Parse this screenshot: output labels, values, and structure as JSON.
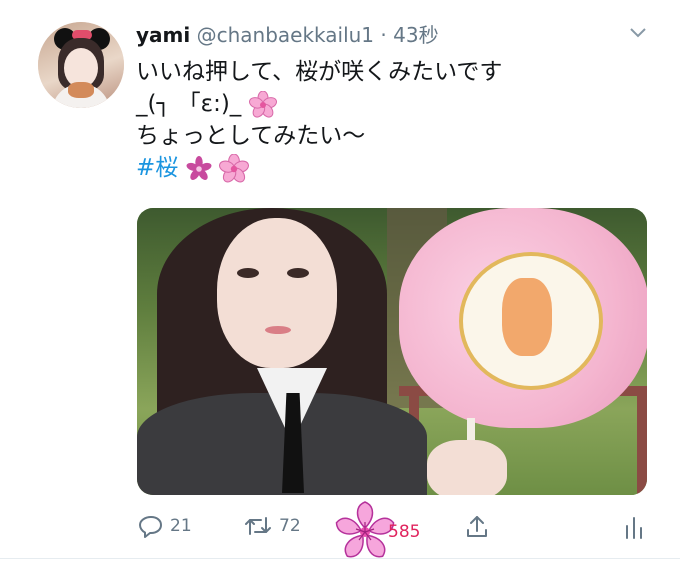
{
  "tweet": {
    "user": {
      "display_name": "yami",
      "handle": "@chanbaekkailu1",
      "separator": "·",
      "time": "43秒"
    },
    "text": {
      "line1": "いいね押して、桜が咲くみたいです",
      "line2": "_(┐ 「ε:)_",
      "line3": "ちょっとしてみたい〜",
      "hashtag": "#桜"
    },
    "actions": {
      "reply_count": "21",
      "retweet_count": "72",
      "like_count": "585"
    },
    "colors": {
      "hashtag_blue": "#1b95e0",
      "muted_gray": "#657786",
      "like_pink": "#e0245e",
      "blossom_pink": "#f0a0d0"
    },
    "icons": [
      "avatar",
      "chevron-down-icon",
      "cherry-blossom-icon",
      "reply-icon",
      "retweet-icon",
      "like-blossom-icon",
      "share-icon",
      "stats-icon"
    ]
  }
}
